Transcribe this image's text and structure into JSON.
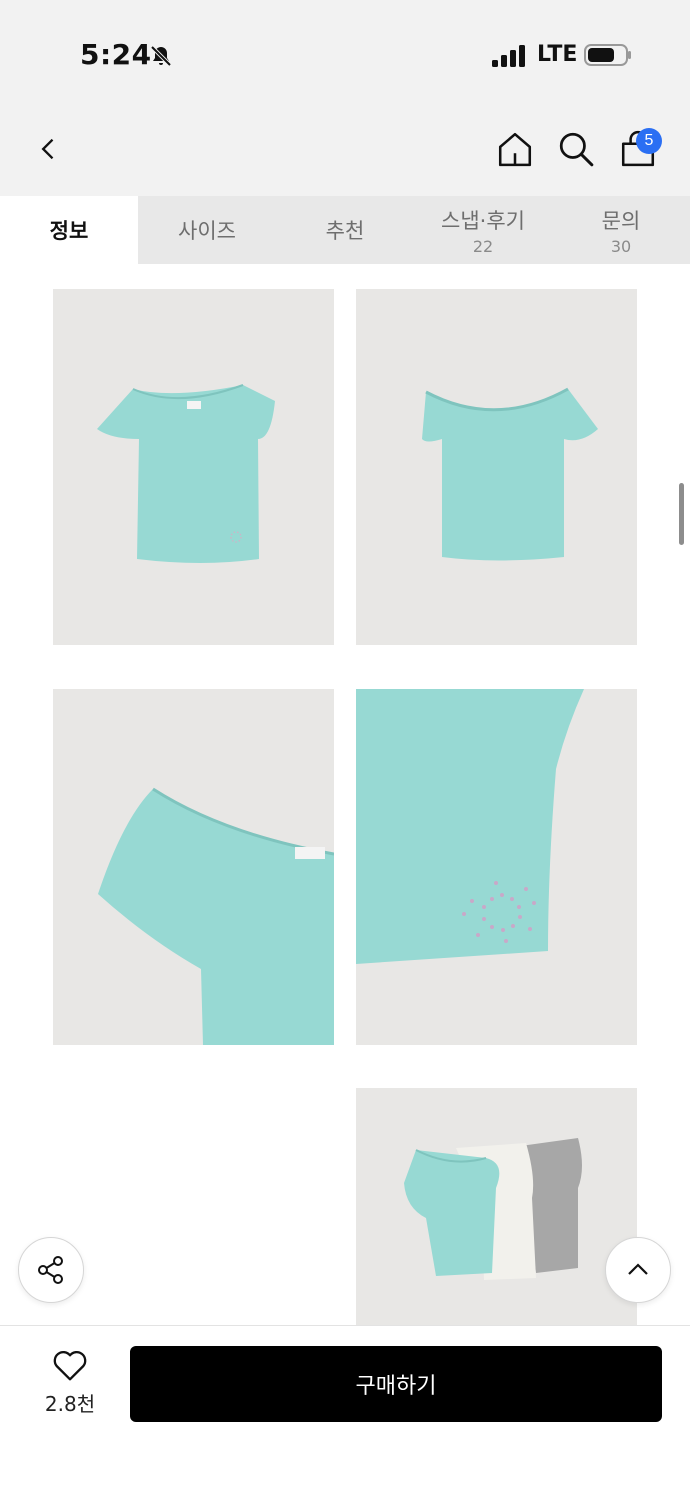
{
  "status": {
    "time": "5:24",
    "network": "LTE"
  },
  "nav": {
    "cart_count": "5"
  },
  "tabs": [
    {
      "label": "정보",
      "count": ""
    },
    {
      "label": "사이즈",
      "count": ""
    },
    {
      "label": "추천",
      "count": ""
    },
    {
      "label": "스냅·후기",
      "count": "22"
    },
    {
      "label": "문의",
      "count": "30"
    }
  ],
  "active_tab": "정보",
  "gallery": [
    {
      "subject": "mint asymmetric top front"
    },
    {
      "subject": "mint top back"
    },
    {
      "subject": "shoulder detail close-up"
    },
    {
      "subject": "hem swirl rhinestone detail"
    },
    {
      "subject": "three color variants"
    }
  ],
  "bottom": {
    "like_count": "2.8천",
    "buy_label": "구매하기"
  },
  "colors": {
    "accent_badge": "#2b6ff3",
    "buy_button": "#000000",
    "mint": "#95d8d2"
  }
}
